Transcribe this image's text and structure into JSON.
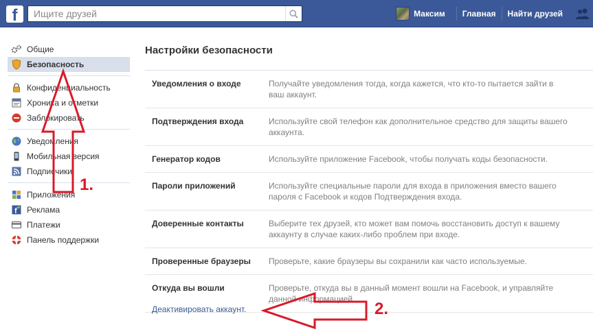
{
  "header": {
    "logo": "f",
    "search_placeholder": "Ищите друзей",
    "user_name": "Максим",
    "nav_home": "Главная",
    "nav_find_friends": "Найти друзей"
  },
  "sidebar": {
    "items": [
      {
        "label": "Общие",
        "icon": "gears-icon"
      },
      {
        "label": "Безопасность",
        "icon": "shield-badge-icon",
        "active": true
      },
      {
        "label": "Конфиденциальность",
        "icon": "lock-icon"
      },
      {
        "label": "Хроника и отметки",
        "icon": "timeline-icon"
      },
      {
        "label": "Заблокировать",
        "icon": "block-icon"
      },
      {
        "label": "Уведомления",
        "icon": "globe-icon"
      },
      {
        "label": "Мобильная версия",
        "icon": "phone-icon"
      },
      {
        "label": "Подписчики",
        "icon": "rss-icon"
      },
      {
        "label": "Приложения",
        "icon": "apps-icon"
      },
      {
        "label": "Реклама",
        "icon": "ads-icon"
      },
      {
        "label": "Платежи",
        "icon": "card-icon"
      },
      {
        "label": "Панель поддержки",
        "icon": "lifebuoy-icon"
      }
    ]
  },
  "main": {
    "title": "Настройки безопасности",
    "rows": [
      {
        "label": "Уведомления о входе",
        "desc": "Получайте уведомления тогда, когда кажется, что кто-то пытается зайти в ваш аккаунт."
      },
      {
        "label": "Подтверждения входа",
        "desc": "Используйте свой телефон как дополнительное средство для защиты вашего аккаунта."
      },
      {
        "label": "Генератор кодов",
        "desc": "Используйте приложение Facebook, чтобы получать коды безопасности."
      },
      {
        "label": "Пароли приложений",
        "desc": "Используйте специальные пароли для входа в приложения вместо вашего пароля с Facebook и кодов Подтверждения входа."
      },
      {
        "label": "Доверенные контакты",
        "desc": "Выберите тех друзей, кто может вам помочь восстановить доступ к вашему аккаунту в случае каких-либо проблем при входе."
      },
      {
        "label": "Проверенные браузеры",
        "desc": "Проверьте, какие браузеры вы сохранили как часто используемые."
      },
      {
        "label": "Откуда вы вошли",
        "desc": "Проверьте, откуда вы в данный момент вошли на Facebook, и управляйте данной информацией."
      }
    ],
    "deactivate_link": "Деактивировать аккаунт."
  },
  "annotations": {
    "step1": "1.",
    "step2": "2.",
    "color": "#d9192a"
  },
  "colors": {
    "brand": "#3b5998",
    "active_bg": "#d8dfea"
  }
}
